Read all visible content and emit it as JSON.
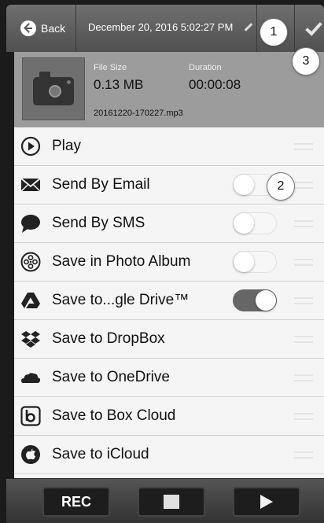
{
  "header": {
    "back_label": "Back",
    "title": "December 20, 2016 5:02:27 PM",
    "edit_icon": "pencil-icon",
    "confirm_icon": "checkmark-icon"
  },
  "badges": [
    "1",
    "2",
    "3"
  ],
  "file": {
    "size_label": "File Size",
    "size_value": "0.13 MB",
    "duration_label": "Duration",
    "duration_value": "00:00:08",
    "filename": "20161220-170227.mp3"
  },
  "actions": [
    {
      "label": "Play",
      "icon": "play-circle-icon"
    },
    {
      "label": "Send By Email",
      "icon": "envelope-icon",
      "toggle": false
    },
    {
      "label": "Send By SMS",
      "icon": "speech-bubble-icon",
      "toggle": false
    },
    {
      "label": "Save in Photo Album",
      "icon": "film-reel-icon",
      "toggle": false
    },
    {
      "label": "Save to...gle Drive™",
      "icon": "google-drive-icon",
      "toggle": true
    },
    {
      "label": "Save to DropBox",
      "icon": "dropbox-icon",
      "toggle": false
    },
    {
      "label": "Save to OneDrive",
      "icon": "onedrive-icon",
      "toggle": false
    },
    {
      "label": "Save to Box Cloud",
      "icon": "box-icon",
      "toggle": false
    },
    {
      "label": "Save to iCloud",
      "icon": "apple-icon",
      "toggle": false
    }
  ],
  "bottom": {
    "rec_label": "REC",
    "stop_icon": "stop-icon",
    "play_icon": "play-icon"
  }
}
